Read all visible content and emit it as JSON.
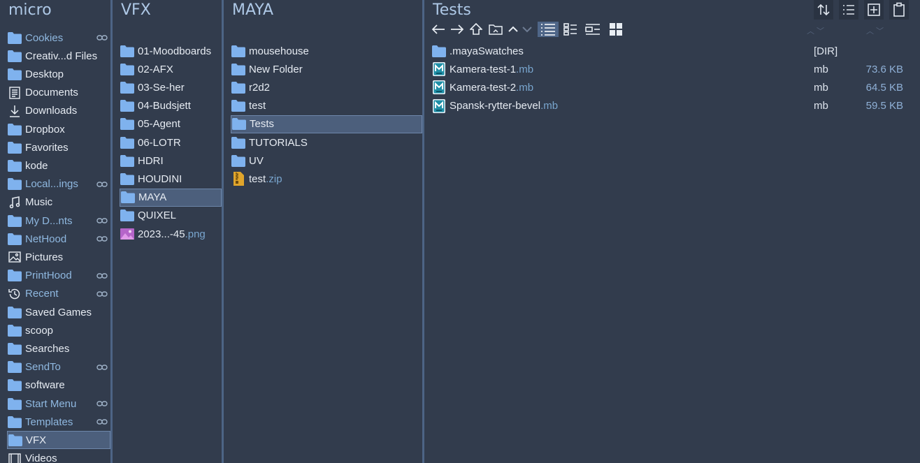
{
  "panes": {
    "micro": {
      "title": "micro",
      "items": [
        {
          "label": "Cookies",
          "icon": "folder-icon",
          "link": true
        },
        {
          "label": "Creativ...d Files",
          "icon": "folder-icon",
          "link": false
        },
        {
          "label": "Desktop",
          "icon": "folder-icon",
          "link": false
        },
        {
          "label": "Documents",
          "icon": "document-icon",
          "link": false
        },
        {
          "label": "Downloads",
          "icon": "download-icon",
          "link": false
        },
        {
          "label": "Dropbox",
          "icon": "folder-icon",
          "link": false
        },
        {
          "label": "Favorites",
          "icon": "folder-icon",
          "link": false
        },
        {
          "label": "kode",
          "icon": "folder-icon",
          "link": false
        },
        {
          "label": "Local...ings",
          "icon": "folder-icon",
          "link": true
        },
        {
          "label": "Music",
          "icon": "music-icon",
          "link": false
        },
        {
          "label": "My D...nts",
          "icon": "folder-icon",
          "link": true
        },
        {
          "label": "NetHood",
          "icon": "folder-icon",
          "link": true
        },
        {
          "label": "Pictures",
          "icon": "pictures-icon",
          "link": false
        },
        {
          "label": "PrintHood",
          "icon": "folder-icon",
          "link": true
        },
        {
          "label": "Recent",
          "icon": "recent-icon",
          "link": true
        },
        {
          "label": "Saved Games",
          "icon": "folder-icon",
          "link": false
        },
        {
          "label": "scoop",
          "icon": "folder-icon",
          "link": false
        },
        {
          "label": "Searches",
          "icon": "folder-icon",
          "link": false
        },
        {
          "label": "SendTo",
          "icon": "folder-icon",
          "link": true
        },
        {
          "label": "software",
          "icon": "folder-icon",
          "link": false
        },
        {
          "label": "Start Menu",
          "icon": "folder-icon",
          "link": true
        },
        {
          "label": "Templates",
          "icon": "folder-icon",
          "link": true
        },
        {
          "label": "VFX",
          "icon": "folder-icon",
          "link": false,
          "selected": true
        },
        {
          "label": "Videos",
          "icon": "videos-icon",
          "link": false
        }
      ]
    },
    "vfx": {
      "title": "VFX",
      "items": [
        {
          "label": "01-Moodboards",
          "ext": ""
        },
        {
          "label": "02-AFX",
          "ext": ""
        },
        {
          "label": "03-Se-her",
          "ext": ""
        },
        {
          "label": "04-Budsjett",
          "ext": ""
        },
        {
          "label": "05-Agent",
          "ext": ""
        },
        {
          "label": "06-LOTR",
          "ext": ""
        },
        {
          "label": "HDRI",
          "ext": ""
        },
        {
          "label": "HOUDINI",
          "ext": ""
        },
        {
          "label": "MAYA",
          "ext": "",
          "selected": true
        },
        {
          "label": "QUIXEL",
          "ext": ""
        },
        {
          "label": "2023...-45",
          "ext": ".png",
          "icon": "image-icon"
        }
      ]
    },
    "maya": {
      "title": "MAYA",
      "items": [
        {
          "label": "mousehouse",
          "ext": ""
        },
        {
          "label": "New Folder",
          "ext": ""
        },
        {
          "label": "r2d2",
          "ext": ""
        },
        {
          "label": "test",
          "ext": ""
        },
        {
          "label": "Tests",
          "ext": "",
          "selected": true
        },
        {
          "label": "TUTORIALS",
          "ext": ""
        },
        {
          "label": "UV",
          "ext": ""
        },
        {
          "label": "test",
          "ext": ".zip",
          "icon": "zip-icon"
        }
      ]
    },
    "tests": {
      "title": "Tests",
      "files": [
        {
          "name": ".mayaSwatches",
          "ext": "",
          "type": "[DIR]",
          "size": "",
          "icon": "folder-icon"
        },
        {
          "name": "Kamera-test-1",
          "ext": ".mb",
          "type": "mb",
          "size": "73.6 KB",
          "icon": "maya-file-icon"
        },
        {
          "name": "Kamera-test-2",
          "ext": ".mb",
          "type": "mb",
          "size": "64.5 KB",
          "icon": "maya-file-icon"
        },
        {
          "name": "Spansk-rytter-bevel",
          "ext": ".mb",
          "type": "mb",
          "size": "59.5 KB",
          "icon": "maya-file-icon"
        }
      ]
    }
  },
  "colors": {
    "background": "#323c4d",
    "title": "#aec8e6",
    "folder": "#7fb2ee",
    "selection": "#4c5f7c",
    "link_text": "#8fb8e0"
  }
}
